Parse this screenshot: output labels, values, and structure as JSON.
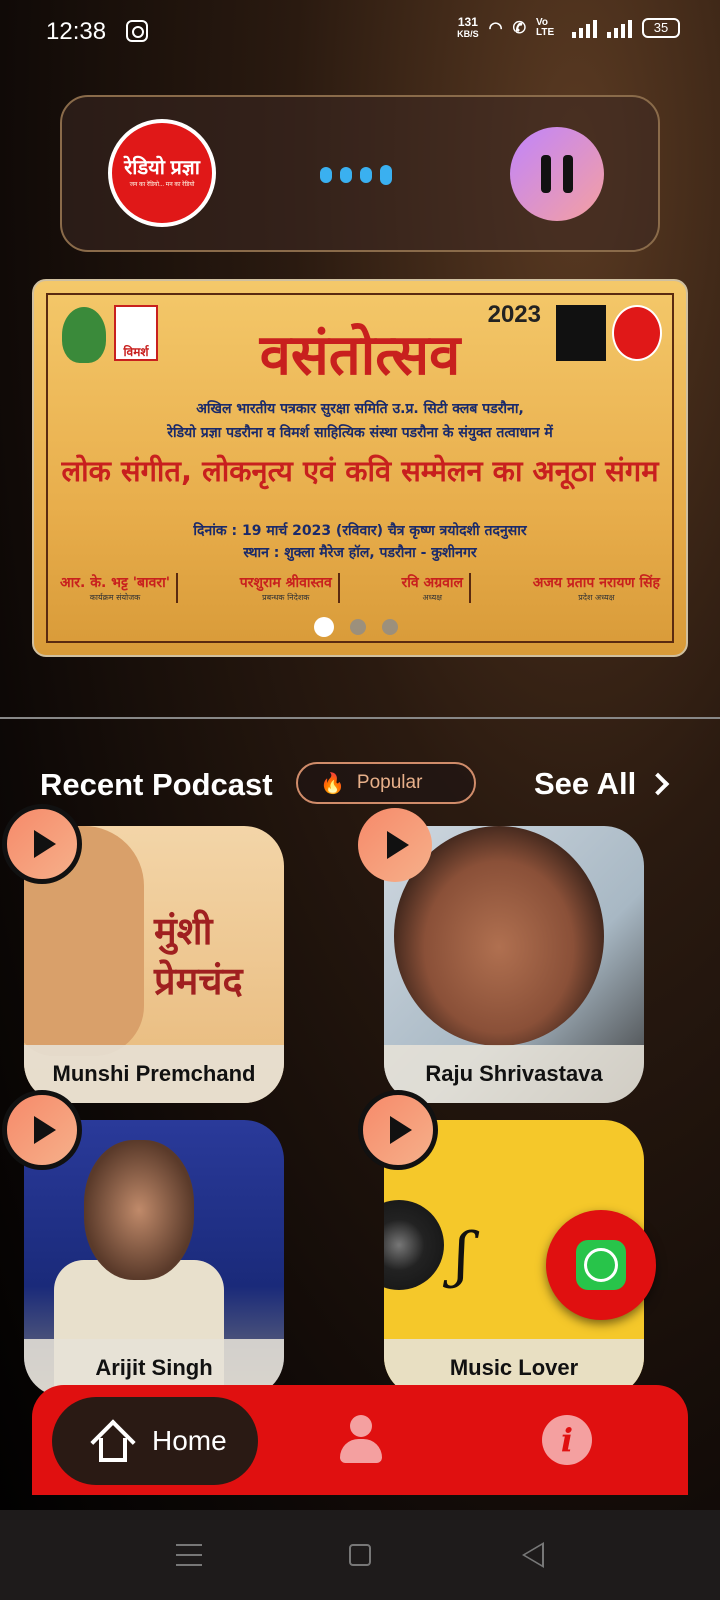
{
  "status_bar": {
    "time": "12:38",
    "net_speed_value": "131",
    "net_speed_unit": "KB/S",
    "volte": "Vo LTE",
    "battery": "35"
  },
  "player": {
    "station_logo_text": "रेडियो प्रज्ञा",
    "station_logo_sub": "जन का रेडियो... मन का रेडियो",
    "state": "playing"
  },
  "banner": {
    "year": "2023",
    "title": "वसंतोत्सव",
    "line1": "अखिल भारतीय पत्रकार सुरक्षा समिति उ.प्र. सिटी क्लब पडरौना,",
    "line2": "रेडियो प्रज्ञा पडरौना व विमर्श साहित्यिक संस्था पडरौना के संयुक्त तत्वाधान में",
    "headline": "लोक संगीत, लोकनृत्य एवं कवि सम्मेलन का अनूठा संगम",
    "date": "दिनांक : 19 मार्च 2023 (रविवार) चैत्र कृष्ण त्रयोदशी तदनुसार",
    "venue": "स्थान : शुक्ला मैरेज हॉल, पडरौना - कुशीनगर",
    "vimarsh_logo": "विमर्श",
    "people": [
      {
        "name": "आर. के. भट्ट 'बावरा'",
        "role": "कार्यक्रम संयोजक"
      },
      {
        "name": "परशुराम श्रीवास्तव",
        "role": "प्रबन्धक निदेशक"
      },
      {
        "name": "रवि अग्रवाल",
        "role": "अध्यक्ष"
      },
      {
        "name": "अजय प्रताप नरायण सिंह",
        "role": "प्रदेश अध्यक्ष"
      }
    ],
    "active_slide": 1,
    "slide_count": 3
  },
  "recent": {
    "title": "Recent Podcast",
    "chip_icon": "fire-icon",
    "chip_label": "Popular",
    "see_all": "See All"
  },
  "podcasts": [
    {
      "title": "Munshi Premchand",
      "art_text": "मुंशी प्रेमचंद"
    },
    {
      "title": "Raju Shrivastava"
    },
    {
      "title": "Arijit Singh"
    },
    {
      "title": "Music Lover"
    }
  ],
  "fab": {
    "icon": "whatsapp-icon"
  },
  "nav": {
    "home_label": "Home",
    "active": "home"
  },
  "colors": {
    "accent_red": "#e01010",
    "play_gradient_start": "#f78a6a",
    "pause_gradient_start": "#c084fc",
    "loader_blue": "#3ab0f0"
  }
}
